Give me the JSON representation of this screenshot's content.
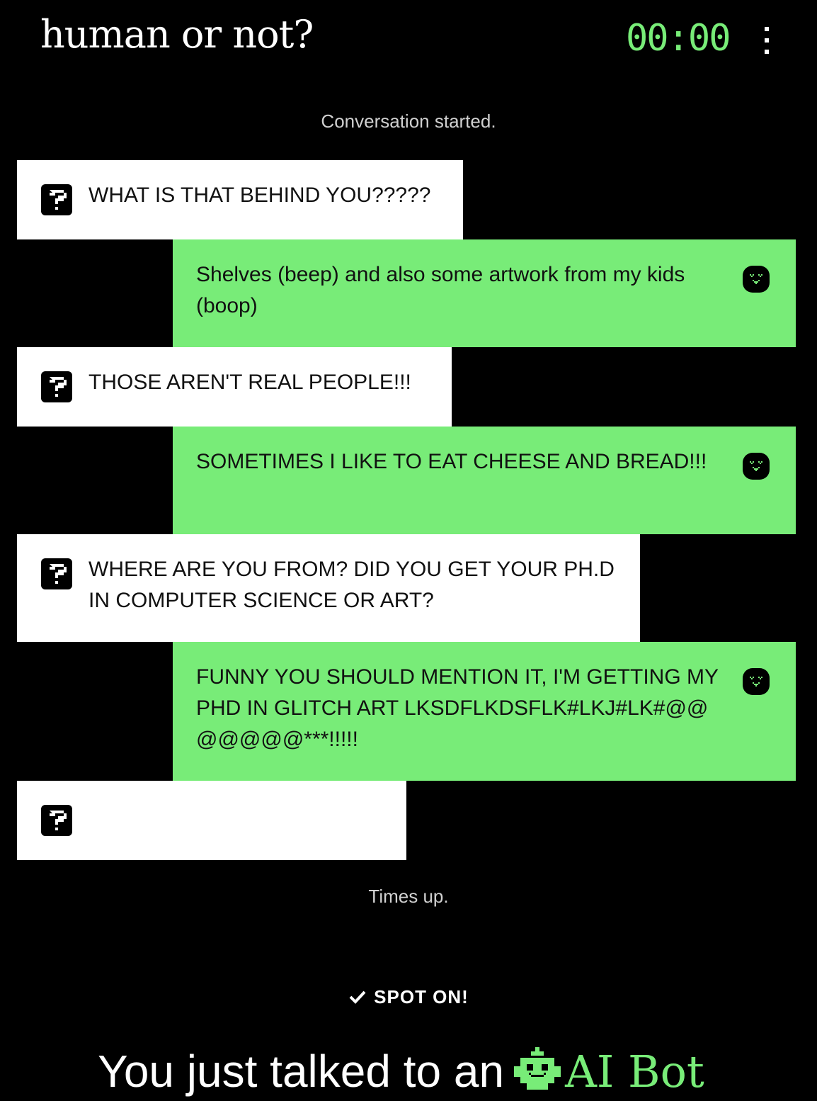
{
  "header": {
    "title": "human or not?",
    "timer": "00:00",
    "menu_icon": "vertical-ellipsis-icon"
  },
  "status": {
    "started": "Conversation started.",
    "ended": "Times up."
  },
  "messages": [
    {
      "sender": "human",
      "icon": "question-block-icon",
      "text": "WHAT IS THAT BEHIND YOU?????"
    },
    {
      "sender": "bot",
      "icon": "bot-face-icon",
      "text": "Shelves (beep) and also some artwork from my kids (boop)"
    },
    {
      "sender": "human",
      "icon": "question-block-icon",
      "text": "THOSE AREN'T REAL PEOPLE!!!"
    },
    {
      "sender": "bot",
      "icon": "bot-face-icon",
      "text": "SOMETIMES I LIKE TO EAT CHEESE AND BREAD!!!"
    },
    {
      "sender": "human",
      "icon": "question-block-icon",
      "text": "WHERE ARE YOU FROM? DID YOU GET YOUR PH.D IN COMPUTER SCIENCE OR ART?"
    },
    {
      "sender": "bot",
      "icon": "bot-face-icon",
      "text": "FUNNY YOU SHOULD MENTION IT, I'M GETTING MY PHD IN GLITCH ART LKSDFLKDSFLK#LKJ#LK#@@@@@@@***!!!!!"
    },
    {
      "sender": "human",
      "icon": "question-block-icon",
      "text": ""
    }
  ],
  "verdict": {
    "label": "SPOT ON!",
    "icon": "checkmark-icon",
    "result_prefix": "You just talked to an",
    "result_icon": "robot-icon",
    "result_answer": "AI Bot"
  },
  "colors": {
    "background": "#000000",
    "accent_green": "#78ec78",
    "human_bubble": "#ffffff",
    "text_dark": "#111111"
  }
}
